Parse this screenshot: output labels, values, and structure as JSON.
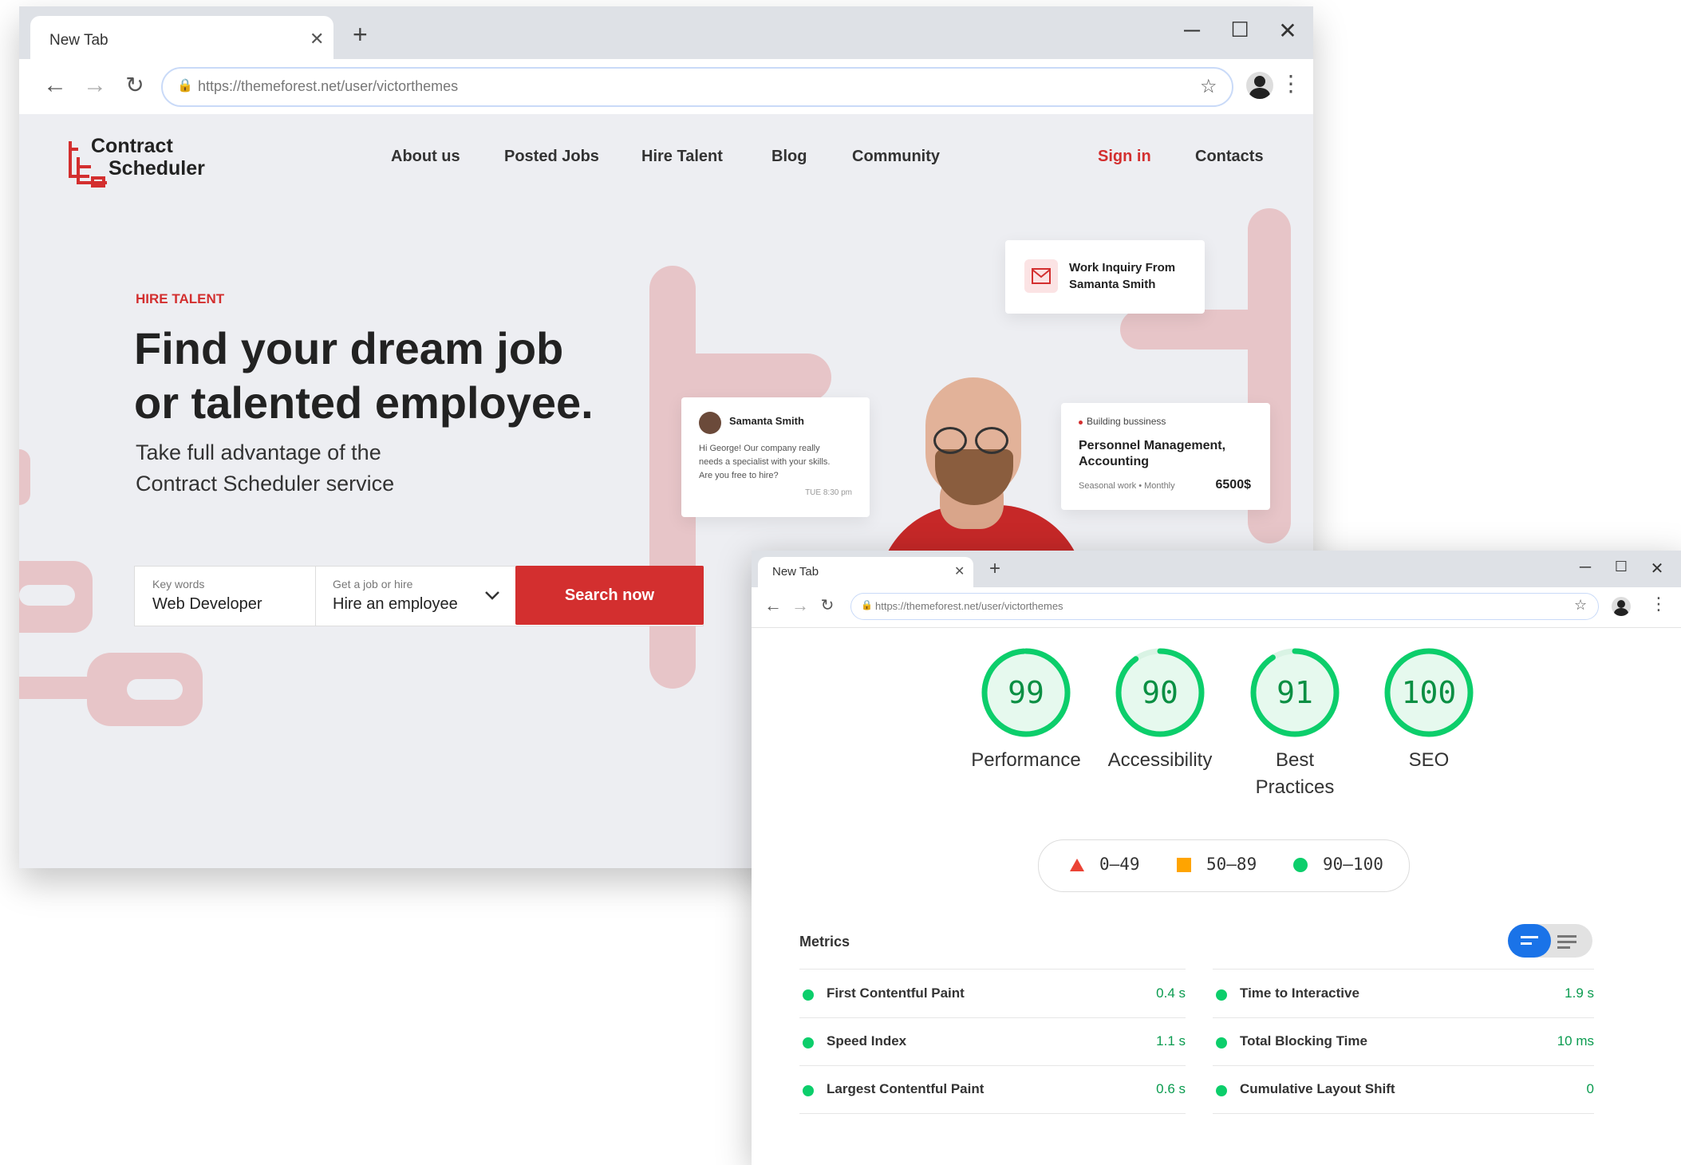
{
  "window_main": {
    "tab_title": "New Tab",
    "url": "https://themeforest.net/user/victorthemes"
  },
  "site": {
    "logo": {
      "line1": "Contract",
      "line2": "Scheduler"
    },
    "nav": [
      "About us",
      "Posted Jobs",
      "Hire Talent",
      "Blog",
      "Community"
    ],
    "signin": "Sign in",
    "contacts": "Contacts",
    "hero": {
      "eyebrow": "HIRE TALENT",
      "headline_1": "Find your dream job",
      "headline_2": "or talented employee.",
      "sub_1": "Take full advantage of the",
      "sub_2": "Contract Scheduler service"
    },
    "search": {
      "keywords_label": "Key words",
      "keywords_value": "Web Developer",
      "type_label": "Get a job or hire",
      "type_value": "Hire an employee",
      "button": "Search now"
    },
    "cards": {
      "inquiry": {
        "line1": "Work Inquiry From",
        "line2": "Samanta Smith"
      },
      "message": {
        "name": "Samanta Smith",
        "line1": "Hi George! Our company really",
        "line2": "needs a specialist with your skills.",
        "line3": "Are you free to hire?",
        "time": "TUE 8:30 pm"
      },
      "job": {
        "tag": "Building bussiness",
        "title_1": "Personnel Management,",
        "title_2": "Accounting",
        "meta": "Seasonal work • Monthly",
        "price": "6500$"
      }
    }
  },
  "window_report": {
    "tab_title": "New Tab",
    "url": "https://themeforest.net/user/victorthemes",
    "scores": [
      {
        "value": "99",
        "label": "Performance",
        "label2": ""
      },
      {
        "value": "90",
        "label": "Accessibility",
        "label2": ""
      },
      {
        "value": "91",
        "label": "Best",
        "label2": "Practices"
      },
      {
        "value": "100",
        "label": "SEO",
        "label2": ""
      }
    ],
    "legend": [
      "0–49",
      "50–89",
      "90–100"
    ],
    "metrics_title": "Metrics",
    "metrics_left": [
      {
        "name": "First Contentful Paint",
        "value": "0.4 s"
      },
      {
        "name": "Speed Index",
        "value": "1.1 s"
      },
      {
        "name": "Largest Contentful Paint",
        "value": "0.6 s"
      }
    ],
    "metrics_right": [
      {
        "name": "Time to Interactive",
        "value": "1.9 s"
      },
      {
        "name": "Total Blocking Time",
        "value": "10 ms"
      },
      {
        "name": "Cumulative Layout Shift",
        "value": "0"
      }
    ]
  },
  "colors": {
    "brand_red": "#d32f2f",
    "score_green": "#0cce6b",
    "score_text_green": "#0a8f43",
    "legend_red": "#eb4335",
    "legend_orange": "#ffa400",
    "toggle_blue": "#1a73e8"
  }
}
